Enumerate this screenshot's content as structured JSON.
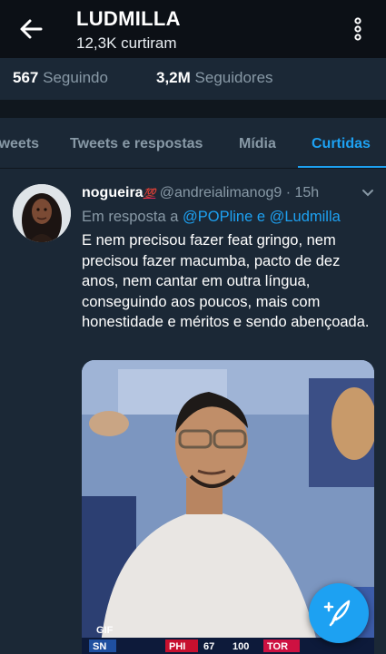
{
  "header": {
    "title": "LUDMILLA",
    "subtitle": "12,3K curtiram"
  },
  "stats": {
    "following_count": "567",
    "following_label": "Seguindo",
    "followers_count": "3,2M",
    "followers_label": "Seguidores"
  },
  "tabs": [
    {
      "label": "Tweets",
      "active": false
    },
    {
      "label": "Tweets e respostas",
      "active": false
    },
    {
      "label": "Mídia",
      "active": false
    },
    {
      "label": "Curtidas",
      "active": true
    }
  ],
  "tweet": {
    "author_name": "nogueira",
    "author_emoji": "💯",
    "handle": "@andreialimanog9",
    "separator": "·",
    "time": "15h",
    "reply_prefix": "Em resposta a",
    "reply_mentions": "@POPline e @Ludmilla",
    "text": "E nem precisou fazer feat gringo, nem precisou fazer macumba, pacto de dez anos, nem cantar em outra língua, conseguindo aos poucos, mais com honestidade e méritos e sendo abençoada.",
    "media": {
      "badge": "GIF",
      "scoreboard": [
        "SN",
        "PHI",
        "67",
        "100",
        "TOR"
      ]
    }
  },
  "colors": {
    "accent": "#1da1f2",
    "background": "#1b2836",
    "header_bg": "#0c1016",
    "muted": "#8899a6"
  },
  "icons": {
    "back": "arrow-left-icon",
    "menu": "more-vertical-icon",
    "caret": "chevron-down-icon",
    "compose": "compose-feather-icon"
  }
}
